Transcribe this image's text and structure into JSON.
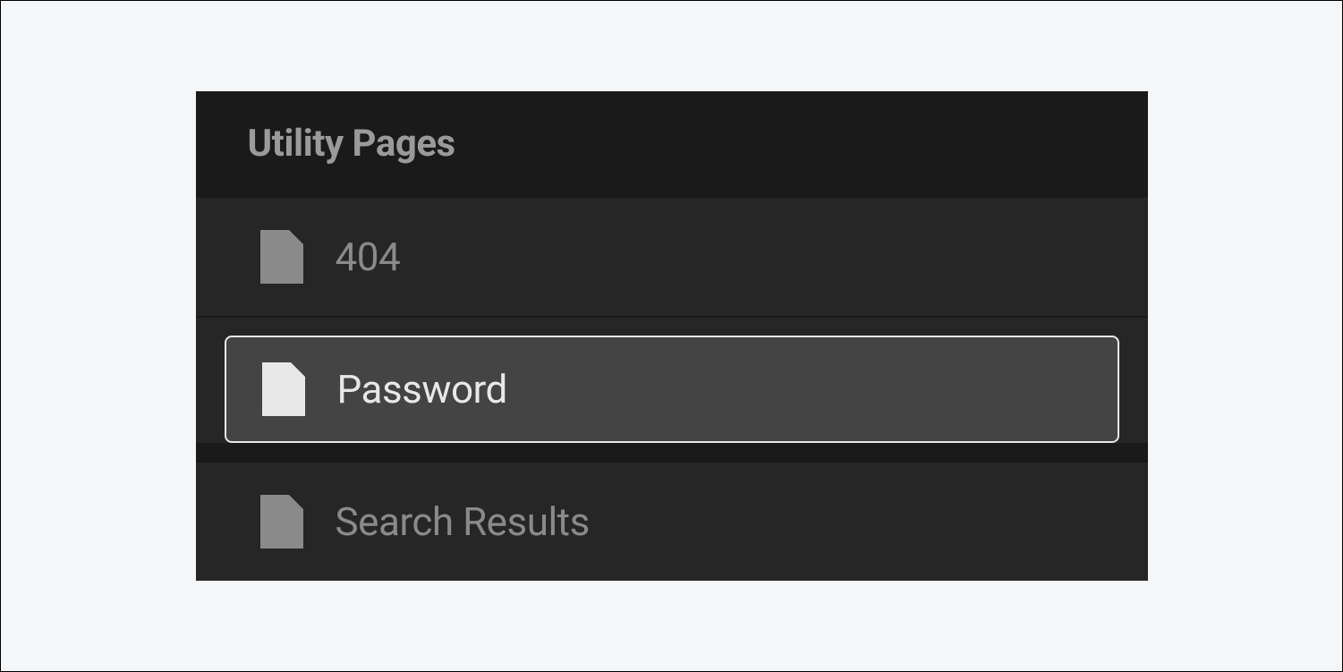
{
  "panel": {
    "title": "Utility Pages",
    "items": [
      {
        "label": "404",
        "selected": false
      },
      {
        "label": "Password",
        "selected": true
      },
      {
        "label": "Search Results",
        "selected": false
      }
    ]
  }
}
